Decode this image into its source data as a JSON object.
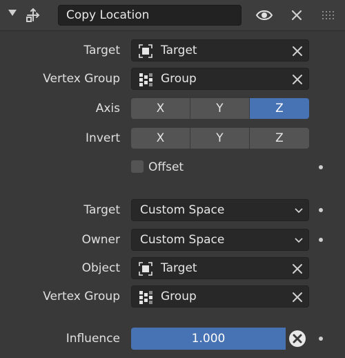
{
  "header": {
    "name": "Copy Location",
    "icons": [
      "collapse-arrow-icon",
      "constraint-move-icon",
      "eye-icon",
      "close-icon",
      "drag-grip-icon"
    ]
  },
  "target": {
    "label": "Target",
    "value": "Target",
    "icon": "object-icon"
  },
  "vertex_group": {
    "label": "Vertex Group",
    "value": "Group",
    "icon": "vertex-group-icon"
  },
  "axis": {
    "label": "Axis",
    "buttons": [
      {
        "label": "X",
        "active": false
      },
      {
        "label": "Y",
        "active": false
      },
      {
        "label": "Z",
        "active": true
      }
    ]
  },
  "invert": {
    "label": "Invert",
    "buttons": [
      {
        "label": "X",
        "active": false
      },
      {
        "label": "Y",
        "active": false
      },
      {
        "label": "Z",
        "active": false
      }
    ]
  },
  "offset": {
    "label": "Offset",
    "checked": false
  },
  "target_space": {
    "label": "Target",
    "value": "Custom Space"
  },
  "owner_space": {
    "label": "Owner",
    "value": "Custom Space"
  },
  "space_object": {
    "label": "Object",
    "value": "Target",
    "icon": "object-icon"
  },
  "space_vertex_group": {
    "label": "Vertex Group",
    "value": "Group",
    "icon": "vertex-group-icon"
  },
  "influence": {
    "label": "Influence",
    "value": "1.000",
    "fraction": 1.0
  },
  "colors": {
    "panel_bg": "#393939",
    "field_bg": "#282828",
    "button_bg": "#545454",
    "accent": "#4772b3"
  }
}
